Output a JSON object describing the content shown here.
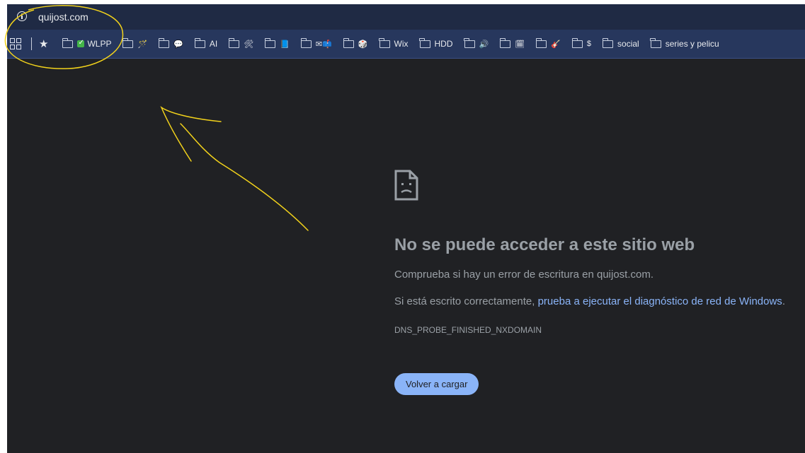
{
  "browser": {
    "url": "quijost.com",
    "info_icon": "info-circle-icon"
  },
  "bookmarks": {
    "apps_icon": "apps-grid-icon",
    "star_icon": "star-icon",
    "items": [
      {
        "label": "WLPP",
        "folder": true
      },
      {
        "label": "",
        "folder": true,
        "emoji": "🪄"
      },
      {
        "label": "",
        "folder": true,
        "emoji": "💬"
      },
      {
        "label": "AI",
        "folder": true
      },
      {
        "label": "",
        "folder": true,
        "emoji": "🛠"
      },
      {
        "label": "",
        "folder": true,
        "emoji": "📘"
      },
      {
        "label": "",
        "folder": true,
        "emoji": "✉📫"
      },
      {
        "label": "",
        "folder": true,
        "emoji": "🎲"
      },
      {
        "label": "Wix",
        "folder": true
      },
      {
        "label": "HDD",
        "folder": true
      },
      {
        "label": "",
        "folder": true,
        "emoji": "🔊"
      },
      {
        "label": "",
        "folder": true,
        "emoji": "🗓"
      },
      {
        "label": "",
        "folder": true,
        "emoji": "🎸"
      },
      {
        "label": "",
        "folder": true,
        "emoji": "$"
      },
      {
        "label": "social",
        "folder": true
      },
      {
        "label": "series y pelicu",
        "folder": true
      }
    ]
  },
  "error_page": {
    "icon": "sad-page-icon",
    "title": "No se puede acceder a este sitio web",
    "check_text": "Comprueba si hay un error de escritura en quijost.com.",
    "if_correct_prefix": "Si está escrito correctamente, ",
    "diagnostic_link": "prueba a ejecutar el diagnóstico de red de Windows",
    "diagnostic_suffix": ".",
    "error_code": "DNS_PROBE_FINISHED_NXDOMAIN",
    "reload_button": "Volver a cargar"
  },
  "colors": {
    "page_bg": "#202124",
    "link": "#8ab4f8",
    "button_bg": "#8ab4f8",
    "annotation": "#f2d21b"
  }
}
